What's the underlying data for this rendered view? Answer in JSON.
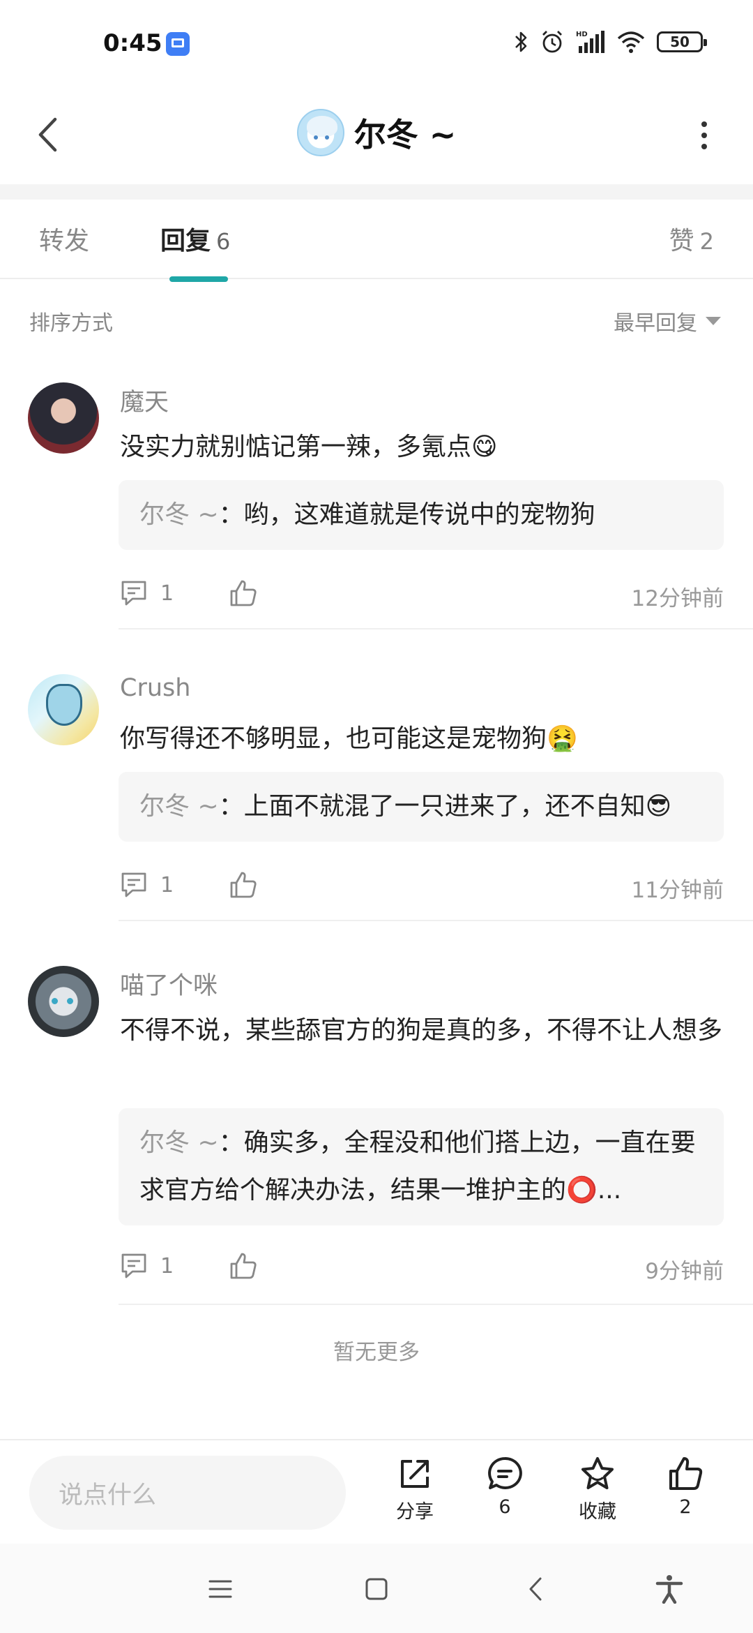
{
  "status_bar": {
    "time": "0:45",
    "battery": "50",
    "icons": [
      "screen-icon",
      "bluetooth-icon",
      "alarm-icon",
      "hd-signal-icon",
      "wifi-icon",
      "battery-icon"
    ]
  },
  "header": {
    "title": "尔冬 ~",
    "back_icon": "chevron-left-icon",
    "more_icon": "more-vertical-icon"
  },
  "tabs": {
    "repost": "转发",
    "reply": "回复",
    "reply_count": "6",
    "like": "赞",
    "like_count": "2"
  },
  "sort": {
    "label": "排序方式",
    "value": "最早回复"
  },
  "comments": [
    {
      "name": "魔天",
      "text": "没实力就别惦记第一辣，多氪点😋",
      "reply_author": "尔冬 ~",
      "reply_text": "：哟，这难道就是传说中的宠物狗",
      "reply_count": "1",
      "time": "12分钟前"
    },
    {
      "name": "Crush",
      "text": "你写得还不够明显，也可能这是宠物狗🤮",
      "reply_author": "尔冬 ~",
      "reply_text": "：上面不就混了一只进来了，还不自知😎",
      "reply_count": "1",
      "time": "11分钟前"
    },
    {
      "name": "喵了个咪",
      "text": "不得不说，某些舔官方的狗是真的多，不得不让人想多",
      "reply_author": "尔冬 ~",
      "reply_text": "：确实多，全程没和他们搭上边，一直在要求官方给个解决办法，结果一堆护主的⭕...",
      "reply_count": "1",
      "time": "9分钟前"
    }
  ],
  "no_more": "暂无更多",
  "bottom_bar": {
    "input_placeholder": "说点什么",
    "share_label": "分享",
    "comment_count": "6",
    "favorite_label": "收藏",
    "like_count": "2"
  },
  "colors": {
    "accent": "#1fa7a7",
    "muted_text": "#888888",
    "reply_bg": "#f6f6f6"
  }
}
